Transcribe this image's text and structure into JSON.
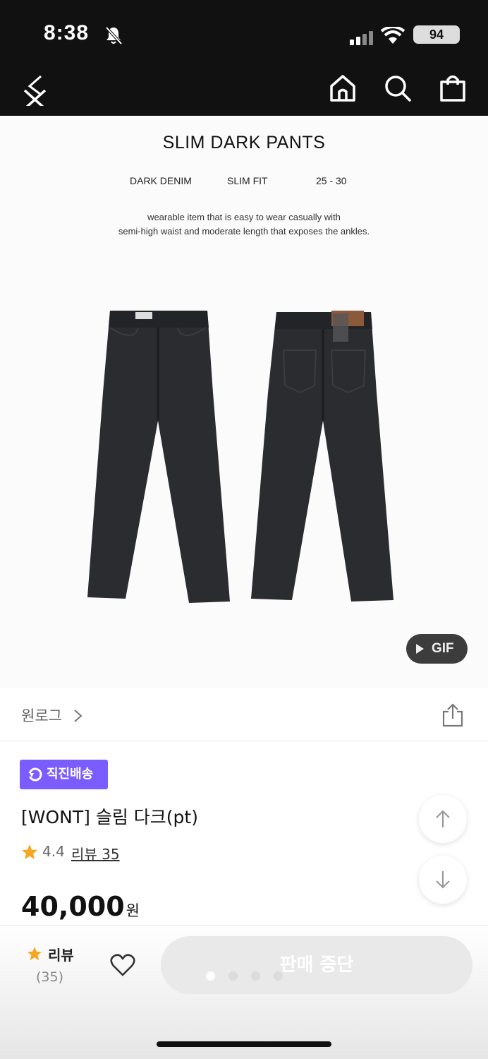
{
  "status_bar": {
    "time": "8:38",
    "battery": "94"
  },
  "header": {
    "back_icon": "close-icon",
    "icons": [
      "home-icon",
      "search-icon",
      "shopping-bag-icon"
    ]
  },
  "hero": {
    "title": "SLIM DARK PANTS",
    "specs": [
      "DARK DENIM",
      "SLIM FIT",
      "25 - 30"
    ],
    "desc_lines": [
      "wearable item that is easy to wear casually with",
      "semi-high waist and moderate length that exposes the ankles."
    ],
    "gif_label": "GIF",
    "pants_color": "#2b2c30"
  },
  "shop": {
    "name": "원로그"
  },
  "product": {
    "badge": "직진배송",
    "badge_color": "#7b5cff",
    "name": "[WONT] 슬림 다크(pt)",
    "rating": "4.4",
    "review_label": "리뷰 35",
    "price": "40,000",
    "currency": "원"
  },
  "bottom_bar": {
    "review_label": "리뷰",
    "review_count": "(35)",
    "cta_label": "판매 중단",
    "image_pages": 4,
    "image_current": 1
  }
}
